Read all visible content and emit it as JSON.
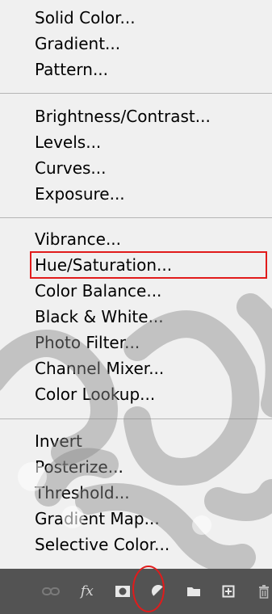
{
  "menu": {
    "group1": [
      "Solid Color...",
      "Gradient...",
      "Pattern..."
    ],
    "group2": [
      "Brightness/Contrast...",
      "Levels...",
      "Curves...",
      "Exposure..."
    ],
    "group3": [
      "Vibrance...",
      "Hue/Saturation...",
      "Color Balance...",
      "Black & White...",
      "Photo Filter...",
      "Channel Mixer...",
      "Color Lookup..."
    ],
    "group4": [
      "Invert",
      "Posterize...",
      "Threshold...",
      "Gradient Map...",
      "Selective Color..."
    ]
  },
  "highlighted_item": "Hue/Saturation...",
  "toolbar": {
    "icons": [
      "link-icon",
      "fx-icon",
      "mask-icon",
      "adjustment-layer-icon",
      "folder-icon",
      "new-layer-icon",
      "trash-icon"
    ],
    "fx_label": "fx"
  },
  "colors": {
    "menu_bg": "#f0f0f0",
    "toolbar_bg": "#535353",
    "highlight": "#e11b1b"
  }
}
